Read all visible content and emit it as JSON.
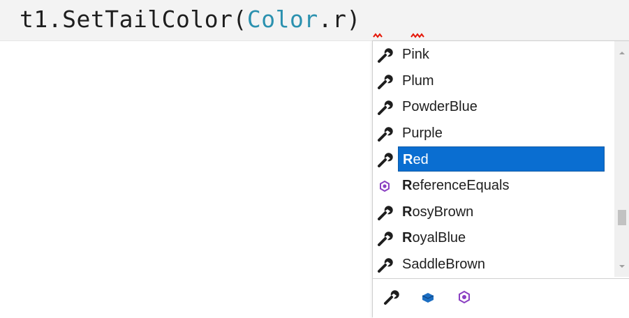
{
  "editor": {
    "code_plain": "t1.SetTailColor(",
    "code_type": "Color",
    "code_rest": ".r)"
  },
  "completion": {
    "items": [
      {
        "icon": "wrench-icon",
        "bold": "",
        "rest": "Pink"
      },
      {
        "icon": "wrench-icon",
        "bold": "",
        "rest": "Plum"
      },
      {
        "icon": "wrench-icon",
        "bold": "",
        "rest": "PowderBlue"
      },
      {
        "icon": "wrench-icon",
        "bold": "",
        "rest": "Purple"
      },
      {
        "icon": "wrench-icon",
        "bold": "R",
        "rest": "ed",
        "selected": true
      },
      {
        "icon": "method-icon",
        "bold": "R",
        "rest": "eferenceEquals"
      },
      {
        "icon": "wrench-icon",
        "bold": "R",
        "rest": "osyBrown"
      },
      {
        "icon": "wrench-icon",
        "bold": "R",
        "rest": "oyalBlue"
      },
      {
        "icon": "wrench-icon",
        "bold": "",
        "rest": "SaddleBrown"
      }
    ],
    "filters": [
      "wrench-icon",
      "class-icon",
      "method-icon"
    ],
    "colors": {
      "selection": "#0a6ed1",
      "method": "#8a3fc2",
      "class": "#1c6ec2",
      "type_token": "#2b91af",
      "error": "#e51400"
    }
  }
}
